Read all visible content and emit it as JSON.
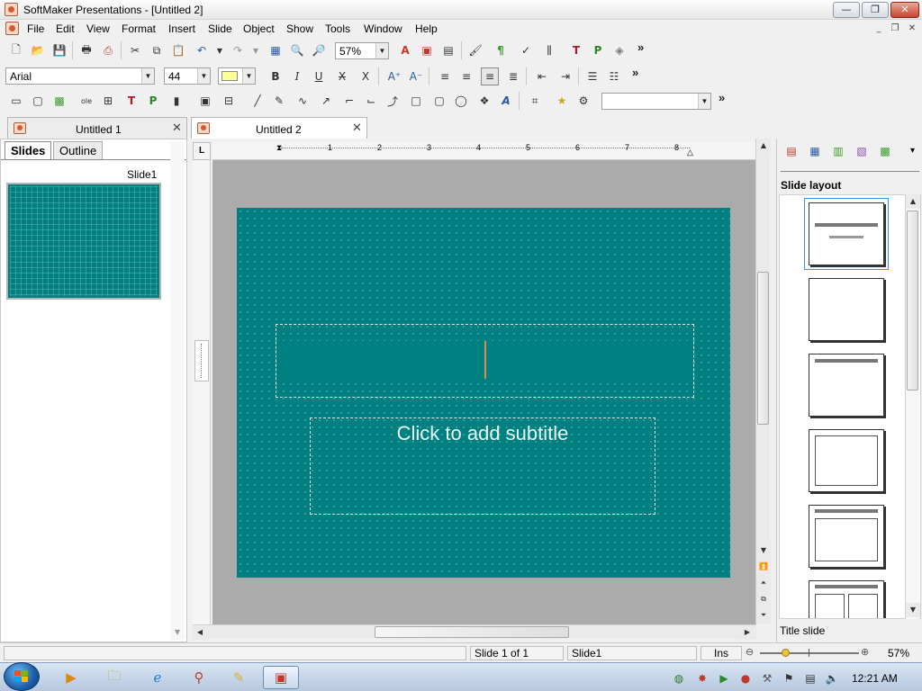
{
  "window": {
    "title": "SoftMaker Presentations - [Untitled 2]",
    "minimize": "—",
    "restore": "❐",
    "close": "✕"
  },
  "menu": {
    "items": [
      "File",
      "Edit",
      "View",
      "Format",
      "Insert",
      "Slide",
      "Object",
      "Show",
      "Tools",
      "Window",
      "Help"
    ],
    "mdi": {
      "minimize": "_",
      "restore": "❐",
      "close": "✕"
    }
  },
  "toolbar1": {
    "zoom": "57%",
    "more": "»"
  },
  "toolbar2": {
    "font": "Arial",
    "size": "44",
    "more": "»"
  },
  "toolbar3": {
    "style_value": "",
    "more": "»"
  },
  "tabs": [
    {
      "label": "Untitled 1",
      "close": "✕"
    },
    {
      "label": "Untitled 2",
      "close": "✕"
    }
  ],
  "left_panel": {
    "tabs": [
      "Slides",
      "Outline"
    ],
    "slide_label": "Slide1"
  },
  "slide": {
    "title_placeholder": "",
    "subtitle_placeholder": "Click to add subtitle"
  },
  "ruler": {
    "marks": [
      "1",
      "2",
      "3",
      "4",
      "5",
      "6",
      "7",
      "8"
    ],
    "corner": "L"
  },
  "right_panel": {
    "heading": "Slide layout",
    "selected_layout": "Title slide",
    "more": "▾"
  },
  "status": {
    "page": "Slide 1 of 1",
    "slide": "Slide1",
    "mode": "Ins",
    "zoom": "57%"
  },
  "taskbar": {
    "clock": "12:21 AM"
  },
  "colors": {
    "slide_bg": "#008080",
    "accent": "#3a8ee6",
    "close": "#c7432e"
  }
}
